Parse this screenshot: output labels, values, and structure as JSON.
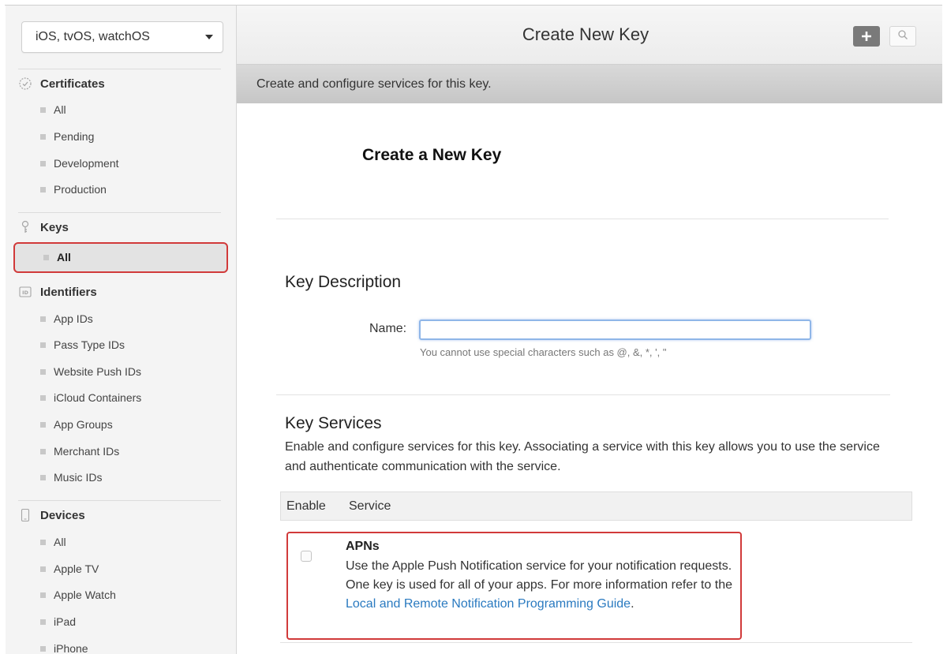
{
  "sidebar": {
    "platform": "iOS, tvOS, watchOS",
    "certificates": {
      "label": "Certificates",
      "items": [
        "All",
        "Pending",
        "Development",
        "Production"
      ]
    },
    "keys": {
      "label": "Keys",
      "items": [
        "All"
      ]
    },
    "identifiers": {
      "label": "Identifiers",
      "items": [
        "App IDs",
        "Pass Type IDs",
        "Website Push IDs",
        "iCloud Containers",
        "App Groups",
        "Merchant IDs",
        "Music IDs"
      ]
    },
    "devices": {
      "label": "Devices",
      "items": [
        "All",
        "Apple TV",
        "Apple Watch",
        "iPad",
        "iPhone"
      ]
    }
  },
  "header": {
    "title": "Create New Key",
    "add_icon": "plus-icon",
    "search_icon": "search-icon"
  },
  "subheader": "Create and configure services for this key.",
  "main": {
    "page_title": "Create a New Key",
    "key_description": {
      "title": "Key Description",
      "name_label": "Name:",
      "name_value": "",
      "hint": "You cannot use special characters such as @, &, *, ', \""
    },
    "key_services": {
      "title": "Key Services",
      "description": "Enable and configure services for this key. Associating a service with this key allows you to use the service and authenticate communication with the service.",
      "col_enable": "Enable",
      "col_service": "Service",
      "services": [
        {
          "name": "APNs",
          "description": "Use the Apple Push Notification service for your notification requests. One key is used for all of your apps. For more information refer to the ",
          "link_text": "Local and Remote Notification Programming Guide",
          "after_link": "."
        }
      ]
    }
  },
  "colors": {
    "highlight": "#d13a3a",
    "link": "#2a7ac0",
    "input_focus": "#8fb6e8"
  }
}
